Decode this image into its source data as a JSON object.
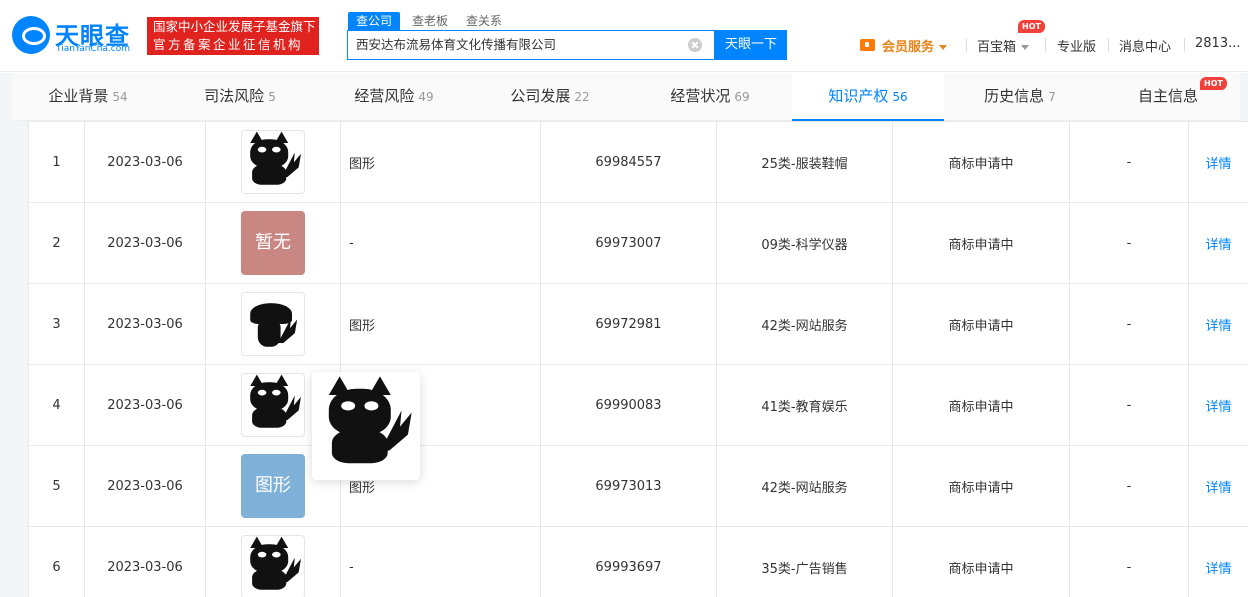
{
  "header": {
    "logo_cn": "天眼查",
    "logo_en": "TianYanCha.com",
    "gov_line1": "国家中小企业发展子基金旗下",
    "gov_line2": "官方备案企业征信机构",
    "search_tabs": [
      "查公司",
      "查老板",
      "查关系"
    ],
    "search_value": "西安达布流易体育文化传播有限公司",
    "search_button": "天眼一下",
    "vip": "会员服务",
    "toolbox": "百宝箱",
    "hot": "HOT",
    "pro": "专业版",
    "messages": "消息中心",
    "user": "2813..."
  },
  "tabs": [
    {
      "label": "企业背景",
      "count": "54"
    },
    {
      "label": "司法风险",
      "count": "5"
    },
    {
      "label": "经营风险",
      "count": "49"
    },
    {
      "label": "公司发展",
      "count": "22"
    },
    {
      "label": "经营状况",
      "count": "69"
    },
    {
      "label": "知识产权",
      "count": "56"
    },
    {
      "label": "历史信息",
      "count": "7"
    },
    {
      "label": "自主信息",
      "count": ""
    }
  ],
  "tab_hot": "HOT",
  "rows": [
    {
      "idx": "1",
      "date": "2023-03-06",
      "image": "cat",
      "name": "图形",
      "reg": "69984557",
      "cls": "25类-服装鞋帽",
      "status": "商标申请中",
      "agent": "-",
      "op": "详情"
    },
    {
      "idx": "2",
      "date": "2023-03-06",
      "image": "暂无",
      "name": "-",
      "reg": "69973007",
      "cls": "09类-科学仪器",
      "status": "商标申请中",
      "agent": "-",
      "op": "详情"
    },
    {
      "idx": "3",
      "date": "2023-03-06",
      "image": "cat-head",
      "name": "图形",
      "reg": "69972981",
      "cls": "42类-网站服务",
      "status": "商标申请中",
      "agent": "-",
      "op": "详情"
    },
    {
      "idx": "4",
      "date": "2023-03-06",
      "image": "cat",
      "name": "",
      "reg": "69990083",
      "cls": "41类-教育娱乐",
      "status": "商标申请中",
      "agent": "-",
      "op": "详情"
    },
    {
      "idx": "5",
      "date": "2023-03-06",
      "image": "图形",
      "name": "图形",
      "reg": "69973013",
      "cls": "42类-网站服务",
      "status": "商标申请中",
      "agent": "-",
      "op": "详情"
    },
    {
      "idx": "6",
      "date": "2023-03-06",
      "image": "cat",
      "name": "-",
      "reg": "69993697",
      "cls": "35类-广告销售",
      "status": "商标申请中",
      "agent": "-",
      "op": "详情"
    }
  ],
  "colors": {
    "brand": "#0084ff",
    "gov_red": "#e0231f",
    "vip_orange": "#e8841a",
    "placeholder_red": "#c98784",
    "placeholder_blue": "#7fb0d8"
  }
}
